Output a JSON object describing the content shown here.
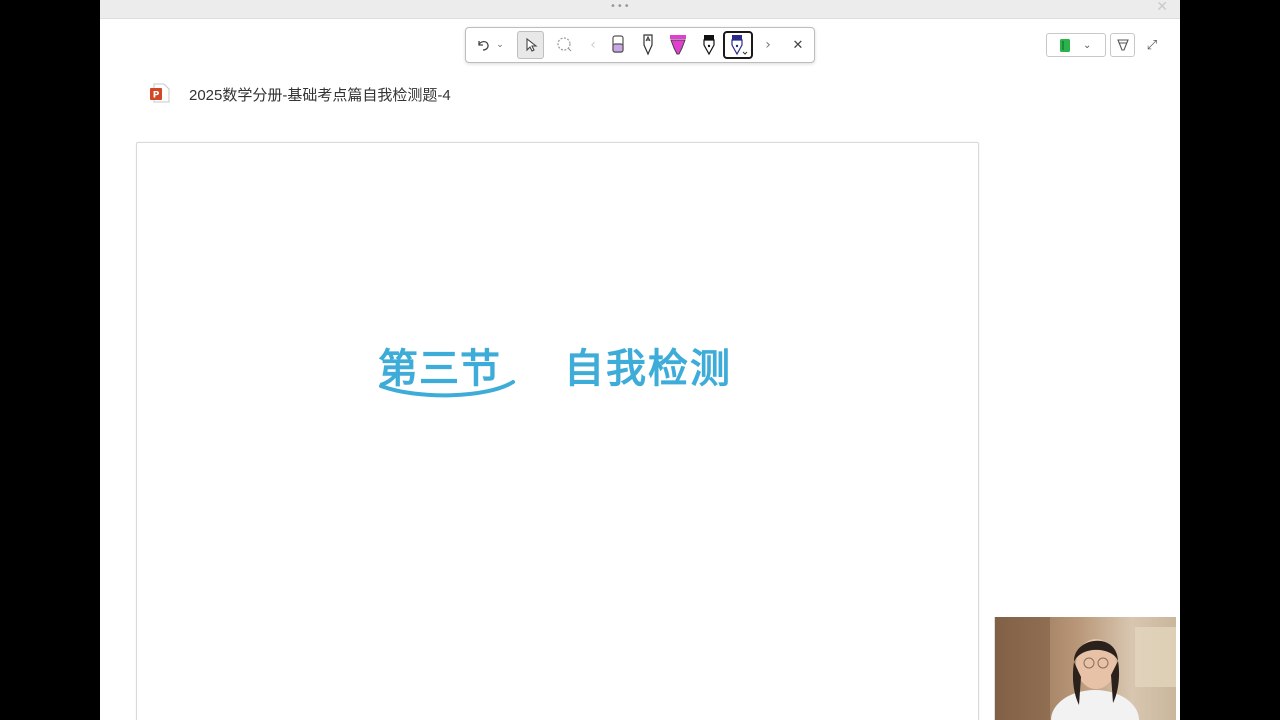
{
  "titlebar": {
    "dots": "•••",
    "close": "✕"
  },
  "toolbar": {
    "undo": "↶",
    "caret": "⌄",
    "next": "›",
    "prev": "‹",
    "close": "✕",
    "tools": [
      "undo-icon",
      "select-icon",
      "lasso-icon",
      "eraser-icon",
      "pen-icon",
      "highlighter-icon",
      "black-pen-icon",
      "blue-pen-icon"
    ]
  },
  "right_tools": {
    "caret": "⌄",
    "expand": "⤢"
  },
  "document": {
    "title": "2025数学分册-基础考点篇自我检测题-4"
  },
  "slide": {
    "section": "第三节",
    "subtitle": "自我检测"
  },
  "colors": {
    "accent": "#3eacd8",
    "highlighter": "#e040d0",
    "notebook_green": "#2bb24c",
    "pen_blue": "#2a2a8a"
  }
}
